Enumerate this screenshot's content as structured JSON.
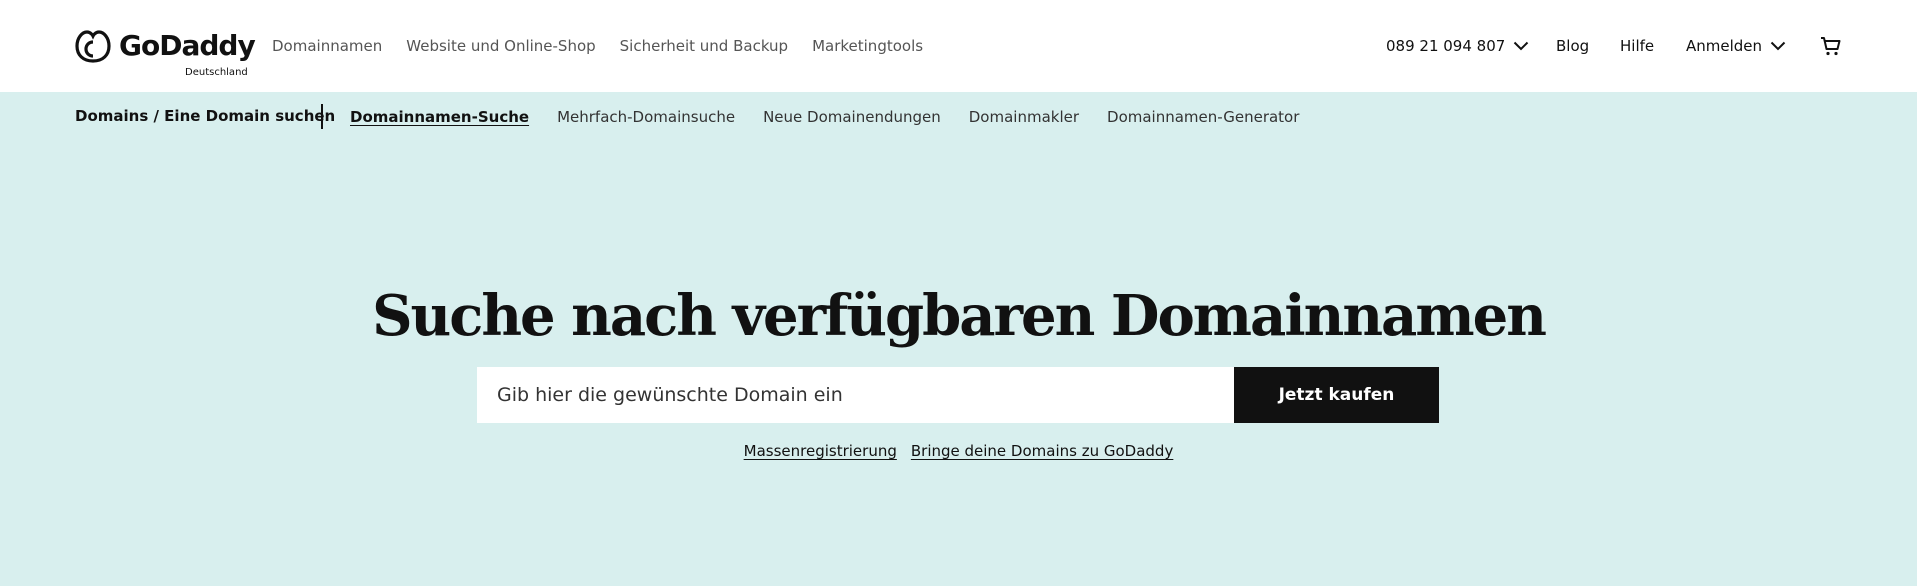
{
  "brand": {
    "name": "GoDaddy",
    "region": "Deutschland"
  },
  "main_nav": [
    {
      "label": "Domainnamen"
    },
    {
      "label": "Website und Online-Shop"
    },
    {
      "label": "Sicherheit und Backup"
    },
    {
      "label": "Marketingtools"
    }
  ],
  "right_nav": {
    "phone": "089 21 094 807",
    "blog": "Blog",
    "help": "Hilfe",
    "signin": "Anmelden"
  },
  "subnav": {
    "breadcrumb": "Domains / Eine Domain suchen",
    "links": [
      {
        "label": "Domainnamen-Suche",
        "active": true
      },
      {
        "label": "Mehrfach-Domainsuche"
      },
      {
        "label": "Neue Domainendungen"
      },
      {
        "label": "Domainmakler"
      },
      {
        "label": "Domainnamen-Generator"
      }
    ]
  },
  "hero": {
    "title": "Suche nach verfügbaren Domainnamen",
    "search_placeholder": "Gib hier die gewünschte Domain ein",
    "search_value": "",
    "buy_label": "Jetzt kaufen",
    "links": [
      {
        "label": "Massenregistrierung"
      },
      {
        "label": "Bringe deine Domains zu GoDaddy"
      }
    ]
  },
  "icons": {
    "logo": "godaddy-logo-icon",
    "phone_dropdown": "chevron-down-icon",
    "signin_dropdown": "chevron-down-icon",
    "cart": "cart-icon"
  },
  "colors": {
    "header_bg": "#ffffff",
    "page_bg": "#d8efee",
    "text": "#111111",
    "button_bg": "#111111",
    "button_text": "#ffffff"
  }
}
